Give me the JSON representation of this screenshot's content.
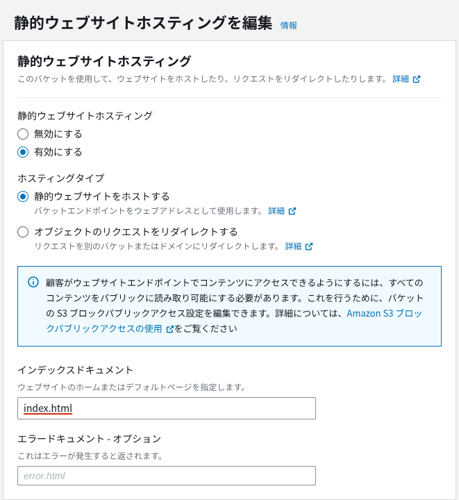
{
  "header": {
    "title": "静的ウェブサイトホスティングを編集",
    "info_label": "情報"
  },
  "panel": {
    "title": "静的ウェブサイトホスティング",
    "desc": "このバケットを使用して、ウェブサイトをホストしたり、リクエストをリダイレクトしたりします。",
    "desc_link": "詳細"
  },
  "hosting": {
    "label": "静的ウェブサイトホスティング",
    "options": {
      "disable": "無効にする",
      "enable": "有効にする"
    }
  },
  "hosting_type": {
    "label": "ホスティングタイプ",
    "static": {
      "label": "静的ウェブサイトをホストする",
      "sub": "バケットエンドポイントをウェブアドレスとして使用します。",
      "link": "詳細"
    },
    "redirect": {
      "label": "オブジェクトのリクエストをリダイレクトする",
      "sub": "リクエストを別のバケットまたはドメインにリダイレクトします。",
      "link": "詳細"
    }
  },
  "info_box": {
    "text_before": "顧客がウェブサイトエンドポイントでコンテンツにアクセスできるようにするには、すべてのコンテンツをパブリックに読み取り可能にする必要があります。これを行うために、バケットの S3 ブロックパブリックアクセス設定を編集できます。詳細については、",
    "link": "Amazon S3 ブロックパブリックアクセスの使用",
    "text_after": "をご覧ください"
  },
  "index_doc": {
    "label": "インデックスドキュメント",
    "sub": "ウェブサイトのホームまたはデフォルトページを指定します。",
    "value": "index.html"
  },
  "error_doc": {
    "label": "エラードキュメント - オプション",
    "sub": "これはエラーが発生すると返されます。",
    "placeholder": "error.html"
  }
}
